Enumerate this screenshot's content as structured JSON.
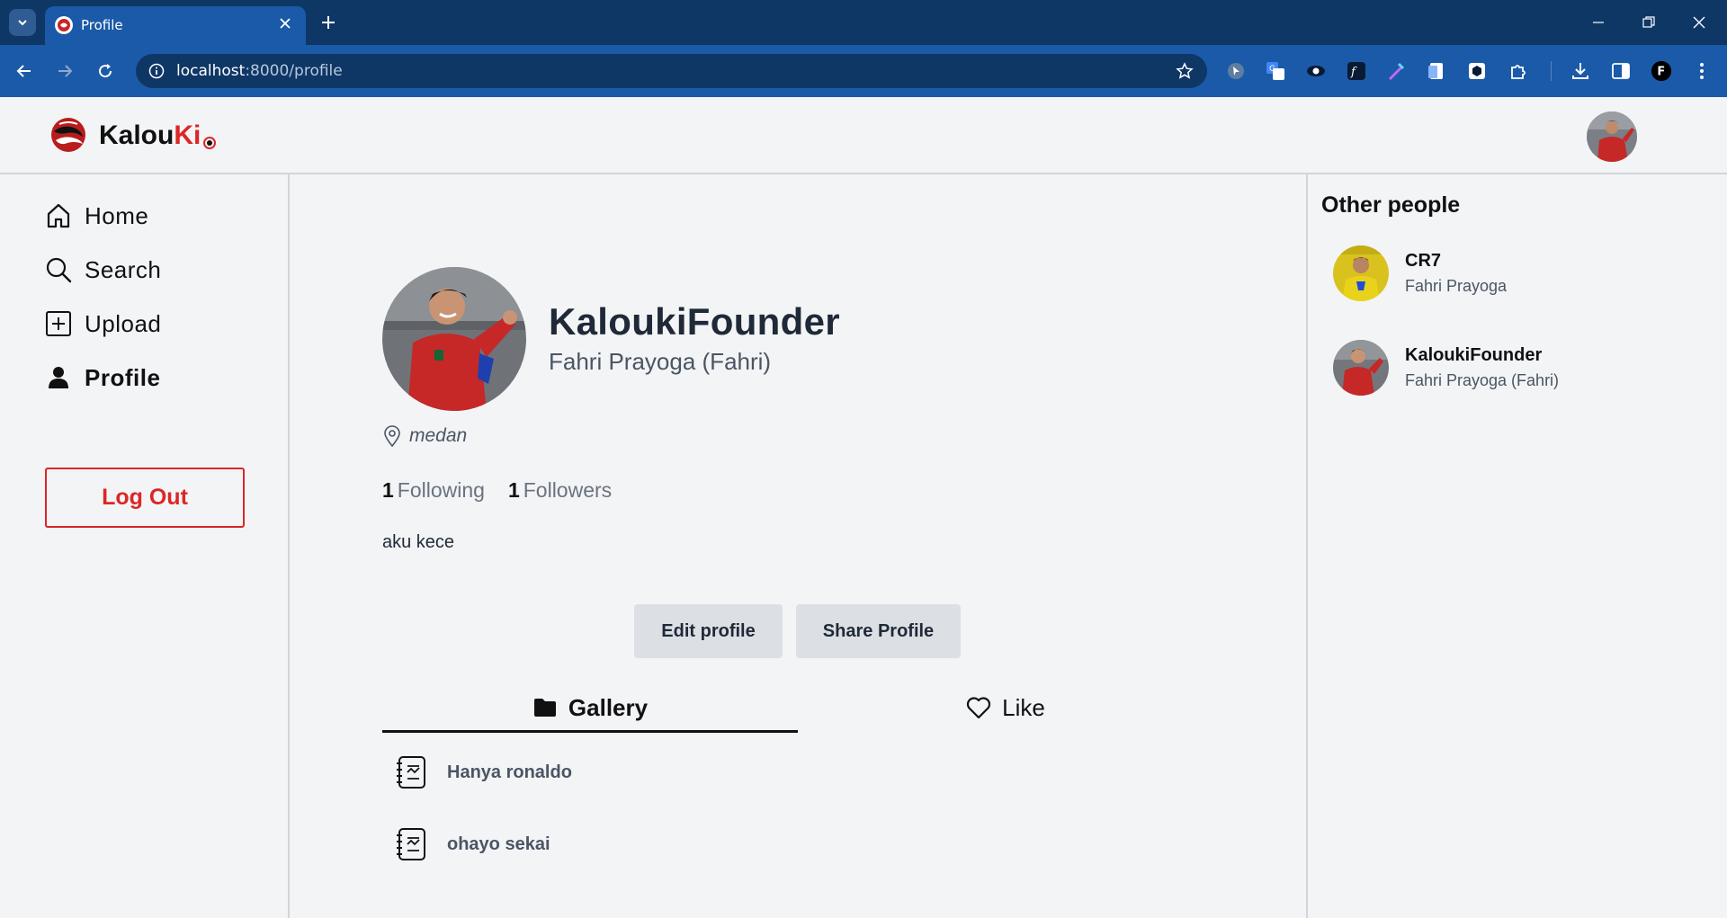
{
  "browser": {
    "tab_title": "Profile",
    "url_host": "localhost",
    "url_rest": ":8000/profile"
  },
  "app": {
    "brand_left": "Kalou",
    "brand_right": "Ki",
    "accent_color": "#dc2626"
  },
  "sidebar": {
    "items": [
      {
        "label": "Home",
        "icon": "home-icon"
      },
      {
        "label": "Search",
        "icon": "search-icon"
      },
      {
        "label": "Upload",
        "icon": "plus-square-icon"
      },
      {
        "label": "Profile",
        "icon": "user-icon",
        "active": true
      }
    ],
    "logout_label": "Log Out"
  },
  "profile": {
    "username": "KaloukiFounder",
    "full_name": "Fahri Prayoga (Fahri)",
    "location": "medan",
    "following_count": "1",
    "following_label": "Following",
    "followers_count": "1",
    "followers_label": "Followers",
    "bio": "aku kece",
    "edit_label": "Edit profile",
    "share_label": "Share Profile"
  },
  "tabs": [
    {
      "label": "Gallery",
      "icon": "folder-icon",
      "active": true
    },
    {
      "label": "Like",
      "icon": "heart-icon",
      "active": false
    }
  ],
  "gallery": [
    {
      "title": "Hanya ronaldo",
      "icon": "album-icon"
    },
    {
      "title": "ohayo sekai",
      "icon": "album-icon"
    }
  ],
  "other_people": {
    "title": "Other people",
    "people": [
      {
        "name": "CR7",
        "subtitle": "Fahri Prayoga"
      },
      {
        "name": "KaloukiFounder",
        "subtitle": "Fahri Prayoga (Fahri)"
      }
    ]
  }
}
